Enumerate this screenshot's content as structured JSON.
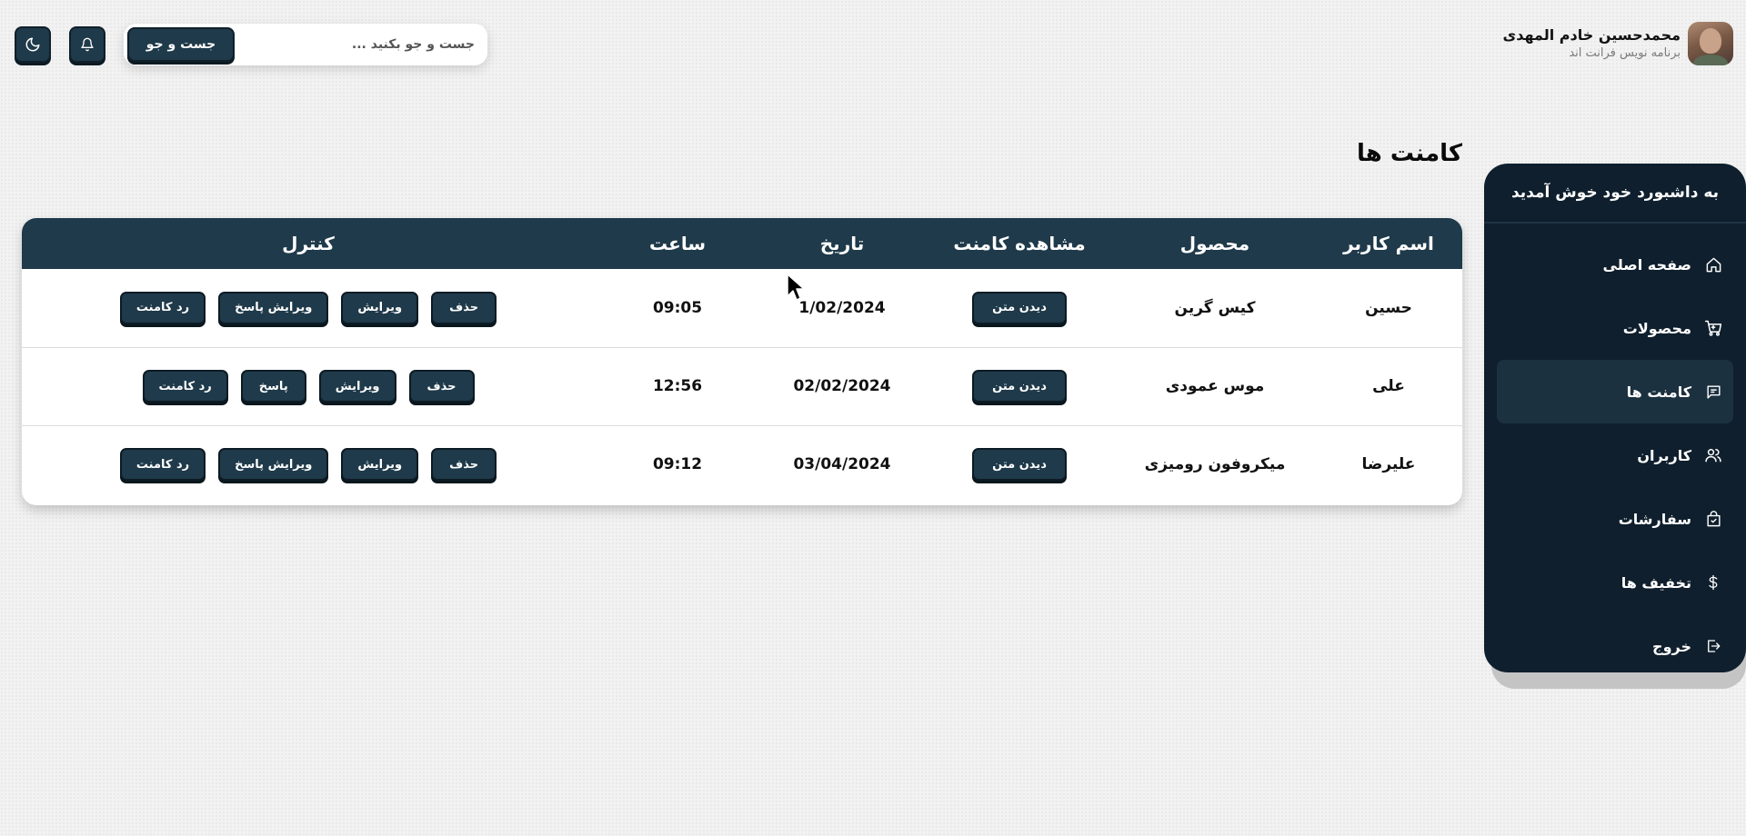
{
  "profile": {
    "name": "محمدحسین خادم المهدی",
    "role": "برنامه نویس فرانت اند"
  },
  "search": {
    "placeholder": "جست و جو بکنید ...",
    "button_label": "جست و جو"
  },
  "topbar_icons": [
    {
      "icon": "bell-icon"
    },
    {
      "icon": "moon-icon"
    }
  ],
  "sidebar": {
    "title": "به داشبورد خود خوش آمدید",
    "items": [
      {
        "label": "صفحه اصلی",
        "icon": "home-icon",
        "active": false
      },
      {
        "label": "محصولات",
        "icon": "cart-icon",
        "active": false
      },
      {
        "label": "کامنت ها",
        "icon": "comment-icon",
        "active": true
      },
      {
        "label": "کاربران",
        "icon": "users-icon",
        "active": false
      },
      {
        "label": "سفارشات",
        "icon": "bag-check-icon",
        "active": false
      },
      {
        "label": "تخفیف ها",
        "icon": "dollar-icon",
        "active": false
      },
      {
        "label": "خروج",
        "icon": "logout-icon",
        "active": false
      }
    ]
  },
  "main": {
    "title": "کامنت ها",
    "table": {
      "headers": {
        "user": "اسم کاربر",
        "product": "محصول",
        "view": "مشاهده کامنت",
        "date": "تاریخ",
        "time": "ساعت",
        "control": "کنترل"
      },
      "rows": [
        {
          "user": "حسین",
          "product": "کیس گرین",
          "view_label": "دیدن متن",
          "date": "1/02/2024",
          "time": "09:05",
          "actions": [
            "حذف",
            "ویرایش",
            "ویرایش پاسخ",
            "رد کامنت"
          ]
        },
        {
          "user": "علی",
          "product": "موس عمودی",
          "view_label": "دیدن متن",
          "date": "02/02/2024",
          "time": "12:56",
          "actions": [
            "حذف",
            "ویرایش",
            "پاسخ",
            "رد کامنت"
          ]
        },
        {
          "user": "علیرضا",
          "product": "میکروفون رومیزی",
          "view_label": "دیدن متن",
          "date": "03/04/2024",
          "time": "09:12",
          "actions": [
            "حذف",
            "ویرایش",
            "ویرایش پاسخ",
            "رد کامنت"
          ]
        }
      ]
    }
  },
  "colors": {
    "sidebar_bg": "#0f1f2d",
    "primary": "#1f3a4a",
    "page_bg": "#f2f2f2"
  }
}
